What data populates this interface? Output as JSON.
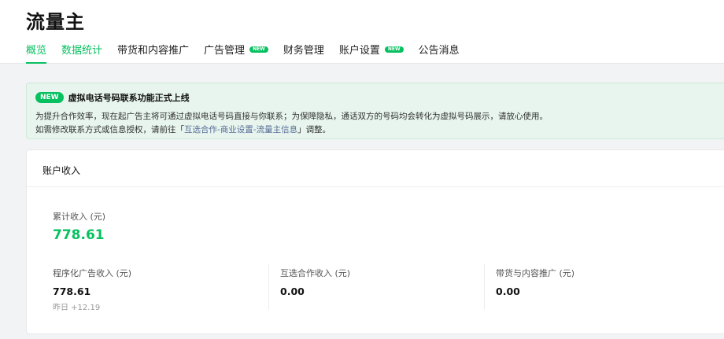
{
  "page_title": "流量主",
  "tabs": [
    {
      "label": "概览",
      "active": true
    },
    {
      "label": "数据统计"
    },
    {
      "label": "带货和内容推广"
    },
    {
      "label": "广告管理",
      "badge": "NEW"
    },
    {
      "label": "财务管理"
    },
    {
      "label": "账户设置",
      "badge": "NEW"
    },
    {
      "label": "公告消息"
    }
  ],
  "notice": {
    "badge": "NEW",
    "title": "虚拟电话号码联系功能正式上线",
    "line1": "为提升合作效率，现在起广告主将可通过虚拟电话号码直接与你联系；为保障隐私，通话双方的号码均会转化为虚拟号码展示，请放心使用。",
    "line2_prefix": "如需修改联系方式或信息授权，请前往「",
    "line2_link": "互选合作-商业设置-流量主信息",
    "line2_suffix": "」调整。"
  },
  "account_income": {
    "title": "账户收入",
    "total_label": "累计收入 (元)",
    "total_value": "778.61",
    "columns": [
      {
        "label": "程序化广告收入 (元)",
        "value": "778.61",
        "sub": "昨日 +12.19"
      },
      {
        "label": "互选合作收入 (元)",
        "value": "0.00"
      },
      {
        "label": "带货与内容推广 (元)",
        "value": "0.00"
      }
    ]
  },
  "colors": {
    "accent": "#07c160",
    "link": "#576b95",
    "notice_bg": "#e7f5ee"
  }
}
